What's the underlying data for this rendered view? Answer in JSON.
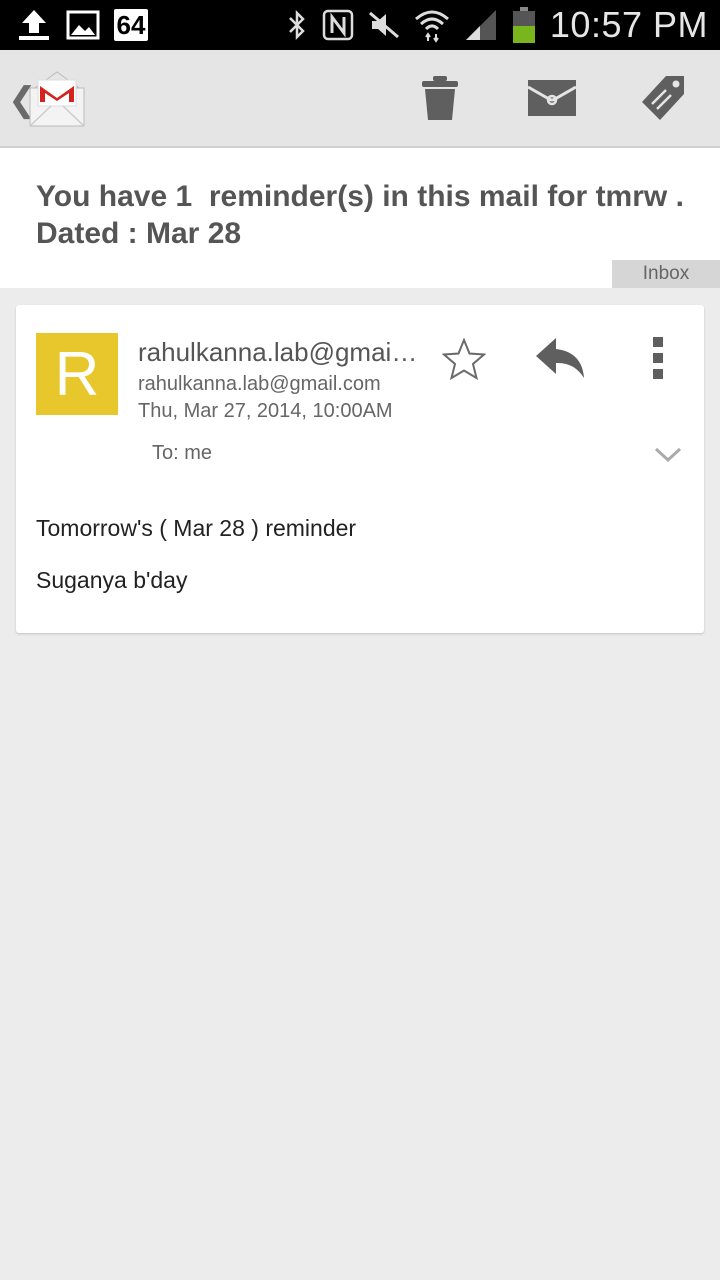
{
  "status_bar": {
    "time": "10:57 PM",
    "notification_count": "64",
    "icons": [
      "upload-icon",
      "image-icon",
      "bluetooth-icon",
      "nfc-icon",
      "mute-icon",
      "wifi-icon",
      "signal-icon",
      "battery-icon"
    ]
  },
  "action_bar": {
    "app": "Gmail",
    "actions": [
      "delete-icon",
      "mark-unread-icon",
      "label-icon"
    ]
  },
  "conversation": {
    "subject": "You have 1  reminder(s) in this mail for tmrw . Dated : Mar 28",
    "label": "Inbox"
  },
  "message": {
    "avatar_letter": "R",
    "avatar_color": "#e8c72d",
    "sender_name": "rahulkanna.lab@gmail.com",
    "sender_email": "rahulkanna.lab@gmail.com",
    "date": "Thu, Mar 27, 2014, 10:00AM",
    "to": "To: me",
    "body": [
      "Tomorrow's ( Mar 28 ) reminder",
      "Suganya b'day"
    ]
  },
  "colors": {
    "status_bar_bg": "#000000",
    "action_bar_bg": "#e5e5e5",
    "page_bg": "#ececec",
    "battery_green": "#7bb51e",
    "gmail_red": "#d4221e"
  }
}
